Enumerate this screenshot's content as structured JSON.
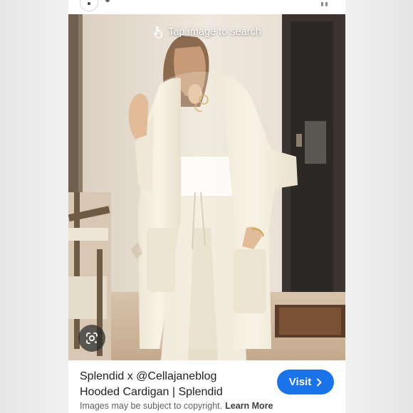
{
  "search_hint": {
    "label": "Tap image to search",
    "icon": "tap-icon"
  },
  "result": {
    "title_line1": "Splendid x @Cellajaneblog",
    "title_line2": "Hooded Cardigan | Splendid",
    "visit_label": "Visit",
    "copyright_text": "Images may be subject to copyright.",
    "learn_more_label": "Learn More"
  },
  "icons": {
    "lens": "lens-icon",
    "visit_chevron": "chevron-right-icon",
    "site": "site-favicon"
  },
  "colors": {
    "accent": "#1a73e8",
    "title_text": "#202124",
    "secondary_text": "#5f6368"
  }
}
